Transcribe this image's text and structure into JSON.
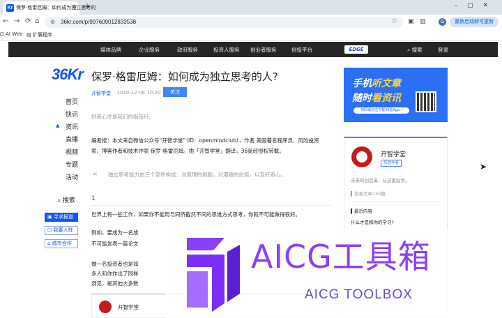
{
  "browser": {
    "tab_title": "保罗·格雷厄姆：如何成为独立思考的",
    "tab_favicon": "Kr",
    "new_tab": "+",
    "url": "36kr.com/p/997609012833538",
    "update_button": "重新启动即可更新",
    "avatar_letter": "G",
    "bookmarks": [
      "AI Web",
      "扩展程序"
    ]
  },
  "site_nav": {
    "items": [
      "媒体品牌",
      "企业服务",
      "政府服务",
      "投资人服务",
      "创业者服务",
      "创投平台"
    ],
    "badge": "EDGE",
    "search": "搜索",
    "login": "登录"
  },
  "logo": "36Kr",
  "left_nav": {
    "items": [
      "首页",
      "快讯",
      "资讯",
      "直播",
      "视频",
      "专题",
      "活动"
    ],
    "search": "搜索",
    "buttons": [
      "寻求报道",
      "我要入驻",
      "城市合作"
    ]
  },
  "article": {
    "title": "保罗·格雷厄姆：如何成为独立思考的人?",
    "author": "开智学堂",
    "date": "· 2020-12-06 10:20",
    "follow": "关注",
    "summary": "好奇心才是我们的指南针。",
    "editor_note_1": "编者按：本文来自微信公众号“开智学堂”（ID：openmindclub），作者 美国著名程序员、风险投资",
    "editor_note_2": "家、博客作者和技术作家 保罗·格雷厄姆。由「开智学堂」翻译，36氪经授权转载。",
    "quote": "独立思考能力由三个部件构成：对真理的挑剔，对灌输的抗拒，以及好奇心。",
    "section_number": "1",
    "p1": "世界上有一些工作，如果你不能用与同侪截然不同的思维方式思考，你就不可能做得很好。",
    "p2a": "例如，要成为一名成",
    "p2b": "不可能发表一篇论文",
    "p3a": "做一名投资者也是如",
    "p3b": "多人和你作出了同样",
    "p3c": "洞见，是其他大多数",
    "card_author": "开智学堂"
  },
  "ad": {
    "line1a": "手机",
    "line1b": "听文章",
    "line2a": "随时",
    "line2b": "看资讯",
    "cta": "扫码或点击下载36氪App ›"
  },
  "author_card": {
    "name": "开智学堂",
    "tag": "特邀作者",
    "desc": "未来的创造者，从这里起步。",
    "stats": "发表文章150篇",
    "recent_label": "最近内容",
    "recent_title": "什么才是和你的学习?"
  },
  "watermark": {
    "title": "AICG工具箱",
    "subtitle": "AICG TOOLBOX",
    "colors": {
      "primary": "#8a3ffc"
    }
  },
  "colors": {
    "brand": "#1456f0",
    "nav_bg": "#262626"
  }
}
